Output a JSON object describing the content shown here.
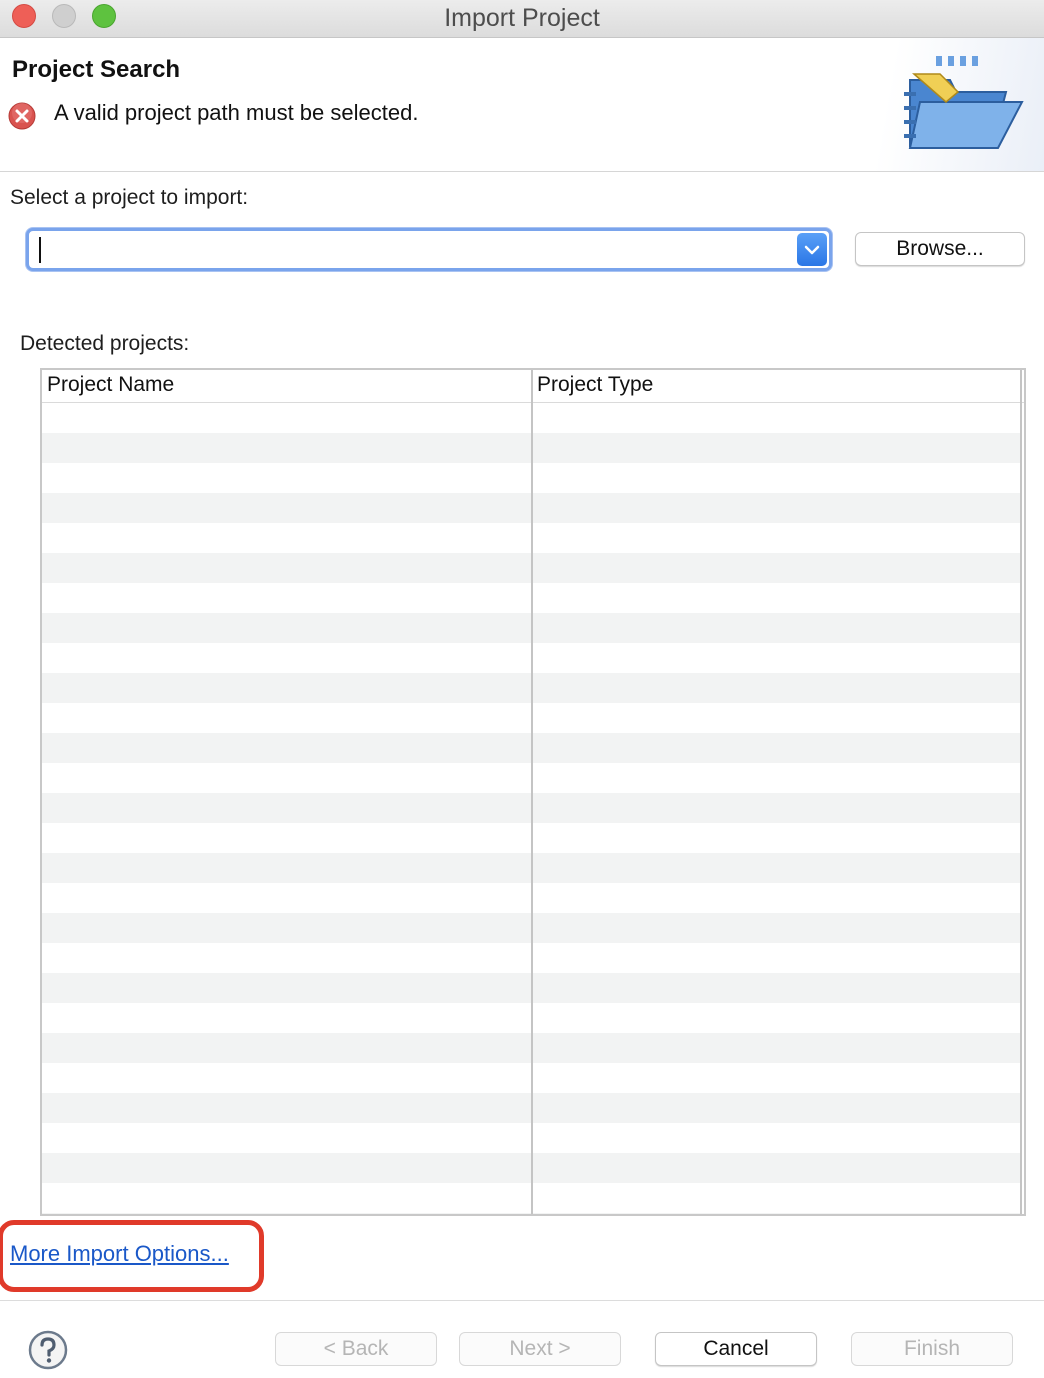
{
  "window": {
    "title": "Import Project"
  },
  "banner": {
    "title": "Project Search",
    "error_message": "A valid project path must be selected."
  },
  "select_project": {
    "label": "Select a project to import:",
    "value": "",
    "browse_label": "Browse..."
  },
  "detected": {
    "label": "Detected projects:",
    "columns": [
      "Project Name",
      "Project Type"
    ],
    "rows": []
  },
  "more_options_link": "More Import Options...",
  "footer": {
    "back_label": "< Back",
    "next_label": "Next >",
    "cancel_label": "Cancel",
    "finish_label": "Finish"
  },
  "colors": {
    "error": "#d9534f",
    "link": "#1a58c8",
    "highlight": "#e03a2a",
    "focus": "#7aa4ec"
  }
}
